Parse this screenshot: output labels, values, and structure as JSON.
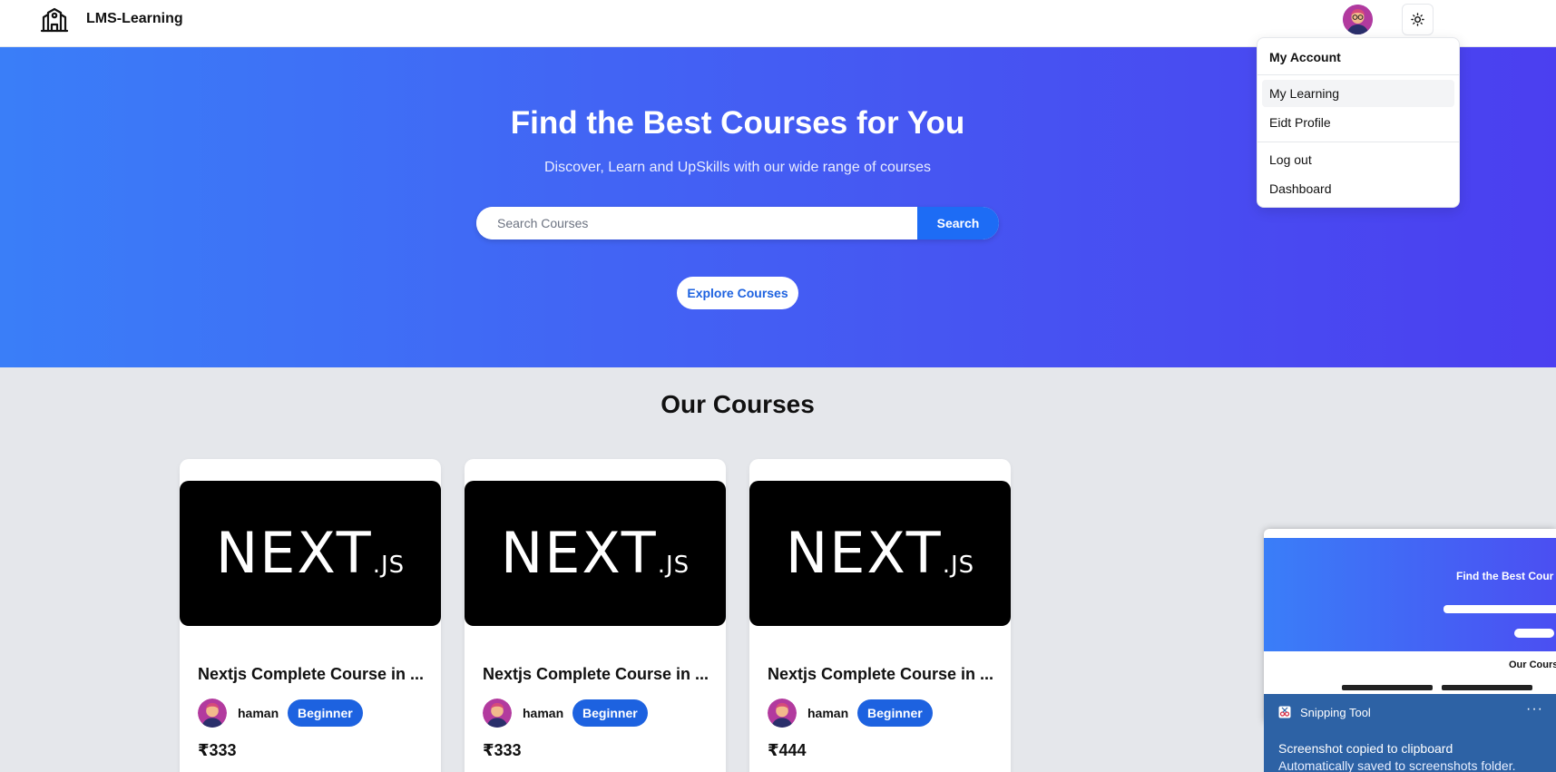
{
  "navbar": {
    "brand": "LMS-Learning",
    "logo_icon": "school-building-icon",
    "theme_icon": "sun-icon"
  },
  "hero": {
    "title": "Find the Best Courses for You",
    "subtitle": "Discover, Learn and UpSkills with our wide range of courses",
    "search_placeholder": "Search Courses",
    "search_value": "",
    "search_button": "Search",
    "explore_button": "Explore Courses"
  },
  "courses": {
    "section_title": "Our Courses",
    "items": [
      {
        "thumbnail_text": "NEXT",
        "thumbnail_suffix": ".JS",
        "title": "Nextjs Complete Course in ...",
        "author": "haman",
        "level": "Beginner",
        "price": "₹333"
      },
      {
        "thumbnail_text": "NEXT",
        "thumbnail_suffix": ".JS",
        "title": "Nextjs Complete Course in ...",
        "author": "haman",
        "level": "Beginner",
        "price": "₹333"
      },
      {
        "thumbnail_text": "NEXT",
        "thumbnail_suffix": ".JS",
        "title": "Nextjs Complete Course in ...",
        "author": "haman",
        "level": "Beginner",
        "price": "₹444"
      }
    ]
  },
  "dropdown": {
    "label": "My Account",
    "items": [
      "My Learning",
      "Eidt Profile",
      "Log out",
      "Dashboard"
    ],
    "active_item": "My Learning"
  },
  "snipping_preview": {
    "title": "Find the Best Cour",
    "section": "Our Course"
  },
  "toast": {
    "app_name": "Snipping Tool",
    "more": "···",
    "line1": "Screenshot copied to clipboard",
    "line2": "Automatically saved to screenshots folder."
  },
  "colors": {
    "accent": "#1d62e0",
    "hero_start": "#3a7ef8",
    "hero_end": "#4b3ff0",
    "toast_bg": "#2d62a5"
  }
}
